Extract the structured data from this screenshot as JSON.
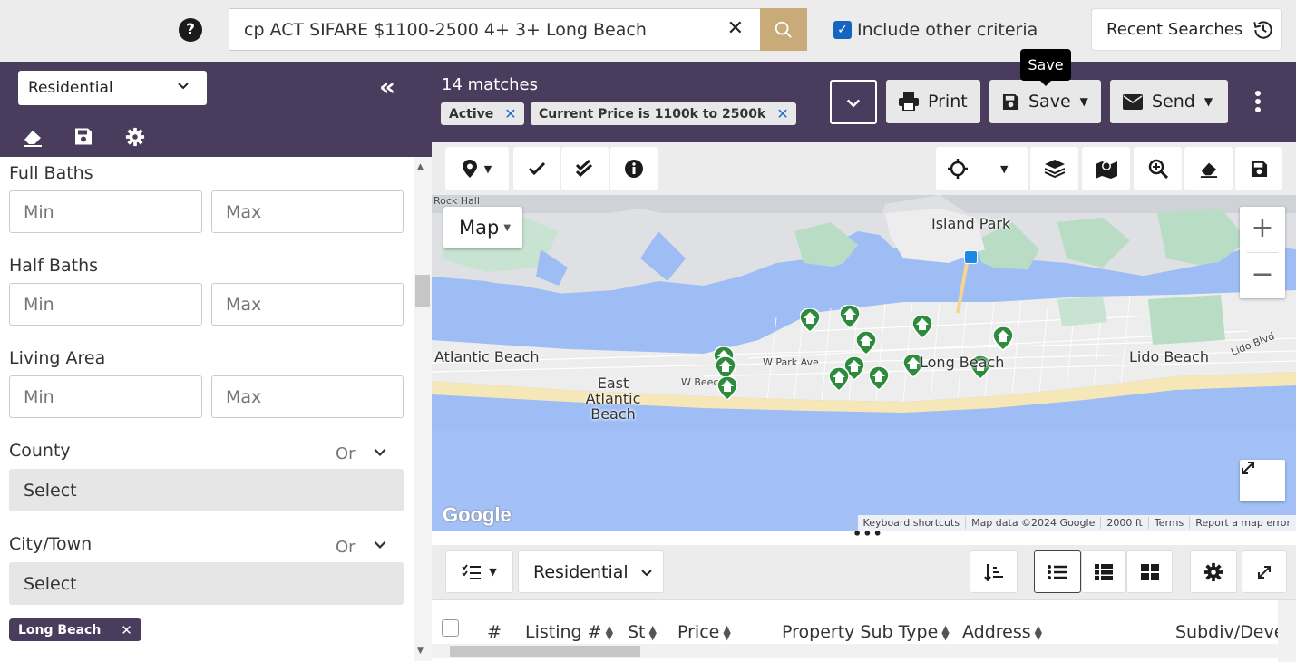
{
  "topbar": {
    "search_value": "cp ACT SIFARE $1100-2500 4+ 3+ Long Beach",
    "include_other_criteria": "Include other criteria",
    "recent_searches": "Recent Searches"
  },
  "sidebar": {
    "property_type": "Residential",
    "filters": {
      "full_baths": {
        "label": "Full Baths",
        "min_placeholder": "Min",
        "max_placeholder": "Max"
      },
      "half_baths": {
        "label": "Half Baths",
        "min_placeholder": "Min",
        "max_placeholder": "Max"
      },
      "living_area": {
        "label": "Living Area",
        "min_placeholder": "Min",
        "max_placeholder": "Max"
      },
      "county": {
        "label": "County",
        "logic": "Or",
        "select": "Select"
      },
      "city_town": {
        "label": "City/Town",
        "logic": "Or",
        "select": "Select",
        "chips": [
          "Long Beach"
        ]
      }
    }
  },
  "results": {
    "match_count": "14 matches",
    "tags": [
      "Active",
      "Current Price is 1100k to 2500k"
    ],
    "print_label": "Print",
    "save_label": "Save",
    "send_label": "Send",
    "save_tooltip": "Save"
  },
  "map": {
    "type_label": "Map",
    "places": {
      "island_park": "Island Park",
      "atlantic_beach": "Atlantic Beach",
      "east_atlantic_beach": "East Atlantic Beach",
      "long_beach": "Long Beach",
      "lido_beach": "Lido Beach"
    },
    "streets": {
      "w_park_ave": "W Park Ave",
      "w_beech": "W Beec",
      "lido_blvd": "Lido Blvd",
      "rock_hall": "Rock Hall"
    },
    "logo": "Google",
    "attribution": [
      "Keyboard shortcuts",
      "Map data ©2024 Google",
      "2000 ft",
      "Terms",
      "Report a map error"
    ],
    "listing_marker_count": 14
  },
  "list": {
    "view_type": "Residential",
    "columns": [
      "#",
      "Listing #",
      "St",
      "Price",
      "Property Sub Type",
      "Address",
      "Subdiv/Deve"
    ]
  },
  "colors": {
    "header_purple": "#4a3c5c",
    "search_button": "#c9ab7a",
    "marker_green": "#2e8b3e",
    "water": "#9fbdf5"
  }
}
